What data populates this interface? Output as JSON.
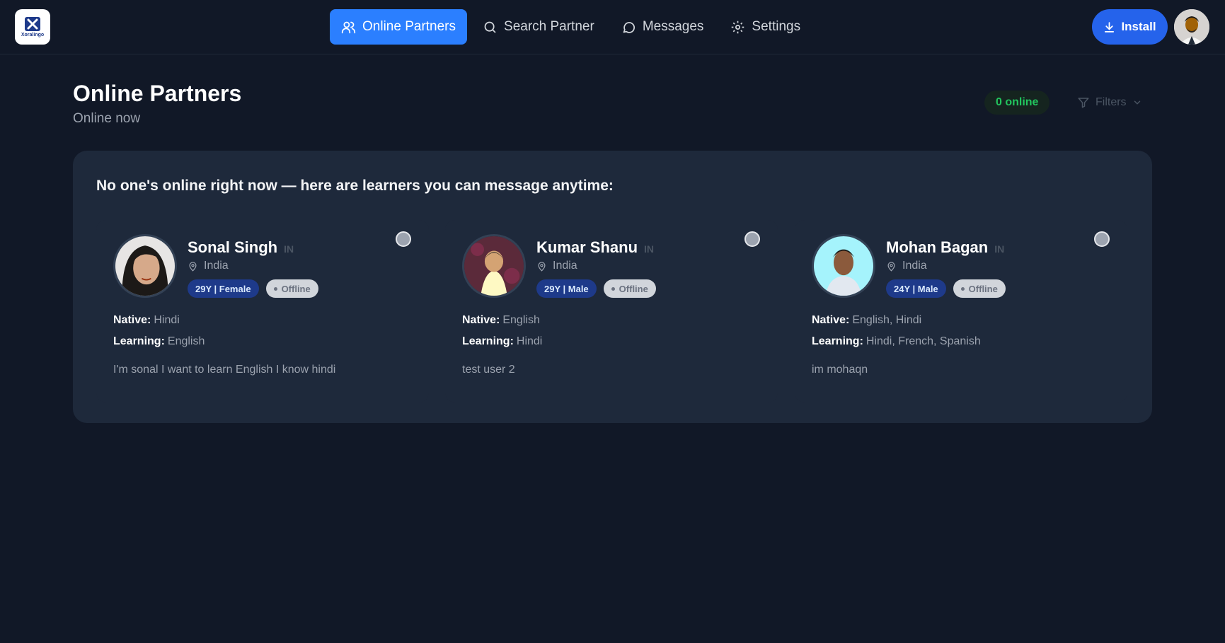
{
  "header": {
    "logo_text": "Xoralingo",
    "nav": [
      {
        "label": "Online Partners",
        "icon": "users-icon",
        "active": true
      },
      {
        "label": "Search Partner",
        "icon": "search-icon",
        "active": false
      },
      {
        "label": "Messages",
        "icon": "message-icon",
        "active": false
      },
      {
        "label": "Settings",
        "icon": "gear-icon",
        "active": false
      }
    ],
    "install_label": "Install"
  },
  "page": {
    "title": "Online Partners",
    "subtitle": "Online now",
    "online_count": "0 online",
    "filters_label": "Filters"
  },
  "panel": {
    "heading": "No one's online right now — here are learners you can message anytime:",
    "native_label": "Native:",
    "learning_label": "Learning:",
    "cards": [
      {
        "name": "Sonal Singh",
        "country_code": "IN",
        "location": "India",
        "age_gender": "29Y | Female",
        "status": "Offline",
        "native": "Hindi",
        "learning": "English",
        "bio": "I'm sonal I want to learn English I know hindi"
      },
      {
        "name": "Kumar Shanu",
        "country_code": "IN",
        "location": "India",
        "age_gender": "29Y | Male",
        "status": "Offline",
        "native": "English",
        "learning": "Hindi",
        "bio": "test user 2"
      },
      {
        "name": "Mohan Bagan",
        "country_code": "IN",
        "location": "India",
        "age_gender": "24Y | Male",
        "status": "Offline",
        "native": "English, Hindi",
        "learning": "Hindi, French, Spanish",
        "bio": "im mohaqn"
      }
    ]
  },
  "colors": {
    "background": "#111827",
    "panel": "#1e293b",
    "accent": "#2b7fff",
    "online_green": "#22c55e"
  }
}
